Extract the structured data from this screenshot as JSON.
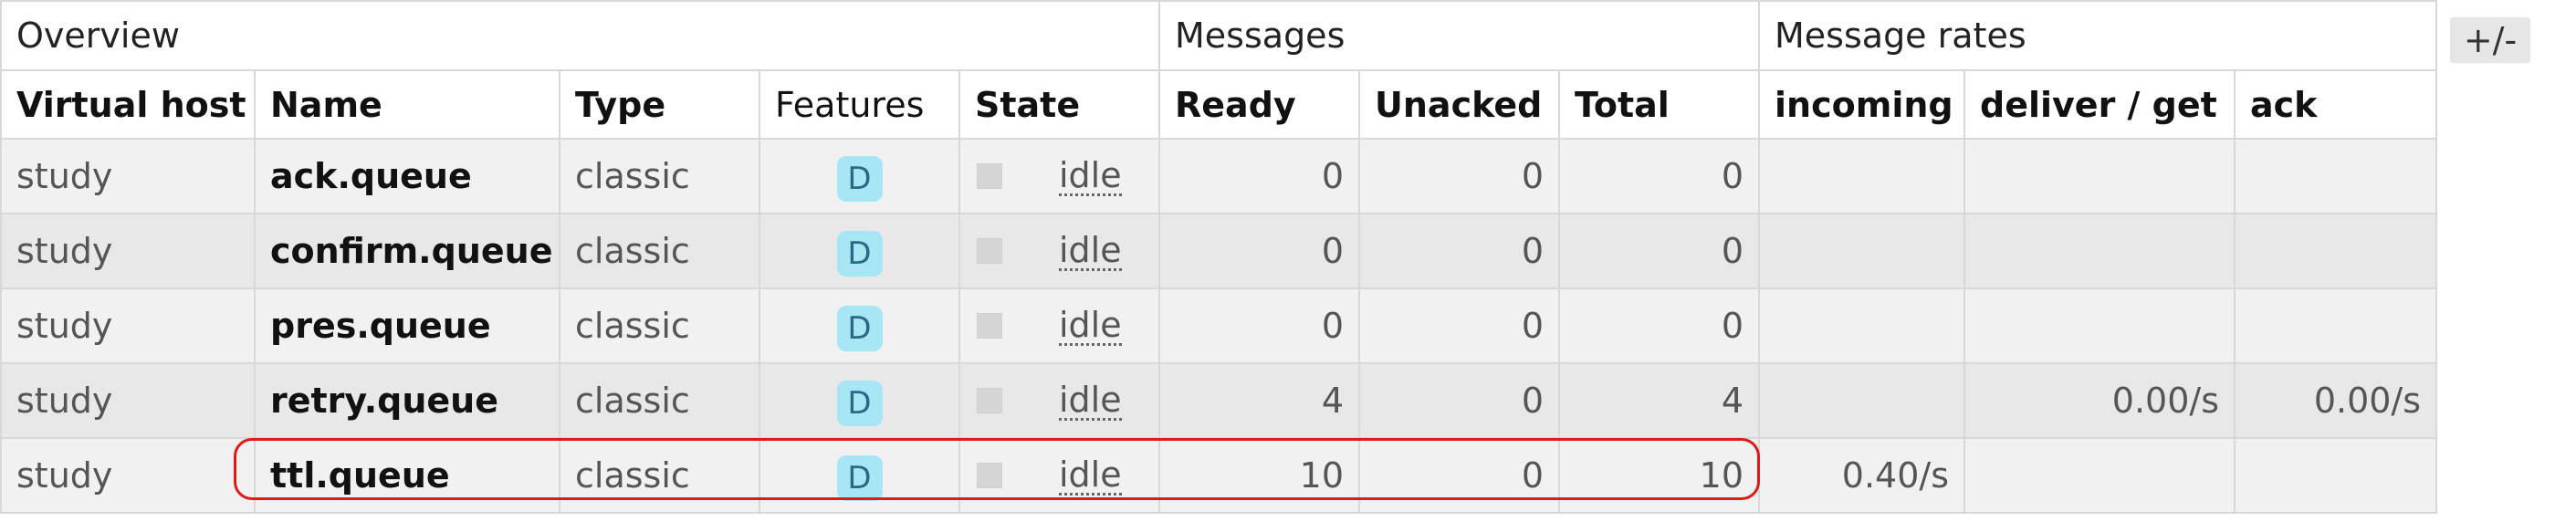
{
  "groups": {
    "overview": "Overview",
    "messages": "Messages",
    "message_rates": "Message rates"
  },
  "columns": {
    "virtual_host": "Virtual host",
    "name": "Name",
    "type": "Type",
    "features": "Features",
    "state": "State",
    "ready": "Ready",
    "unacked": "Unacked",
    "total": "Total",
    "incoming": "incoming",
    "deliver_get": "deliver / get",
    "ack": "ack"
  },
  "toggle_columns_label": "+/-",
  "rows": [
    {
      "vhost": "study",
      "name": "ack.queue",
      "type": "classic",
      "feature": "D",
      "state": "idle",
      "ready": "0",
      "unacked": "0",
      "total": "0",
      "incoming": "",
      "deliver_get": "",
      "ack": ""
    },
    {
      "vhost": "study",
      "name": "confirm.queue",
      "type": "classic",
      "feature": "D",
      "state": "idle",
      "ready": "0",
      "unacked": "0",
      "total": "0",
      "incoming": "",
      "deliver_get": "",
      "ack": ""
    },
    {
      "vhost": "study",
      "name": "pres.queue",
      "type": "classic",
      "feature": "D",
      "state": "idle",
      "ready": "0",
      "unacked": "0",
      "total": "0",
      "incoming": "",
      "deliver_get": "",
      "ack": ""
    },
    {
      "vhost": "study",
      "name": "retry.queue",
      "type": "classic",
      "feature": "D",
      "state": "idle",
      "ready": "4",
      "unacked": "0",
      "total": "4",
      "incoming": "",
      "deliver_get": "0.00/s",
      "ack": "0.00/s"
    },
    {
      "vhost": "study",
      "name": "ttl.queue",
      "type": "classic",
      "feature": "D",
      "state": "idle",
      "ready": "10",
      "unacked": "0",
      "total": "10",
      "incoming": "0.40/s",
      "deliver_get": "",
      "ack": ""
    }
  ],
  "highlighted_row": "ttl.queue",
  "colors": {
    "highlight": "#e01919",
    "feature_badge": "#a6e6f5"
  }
}
